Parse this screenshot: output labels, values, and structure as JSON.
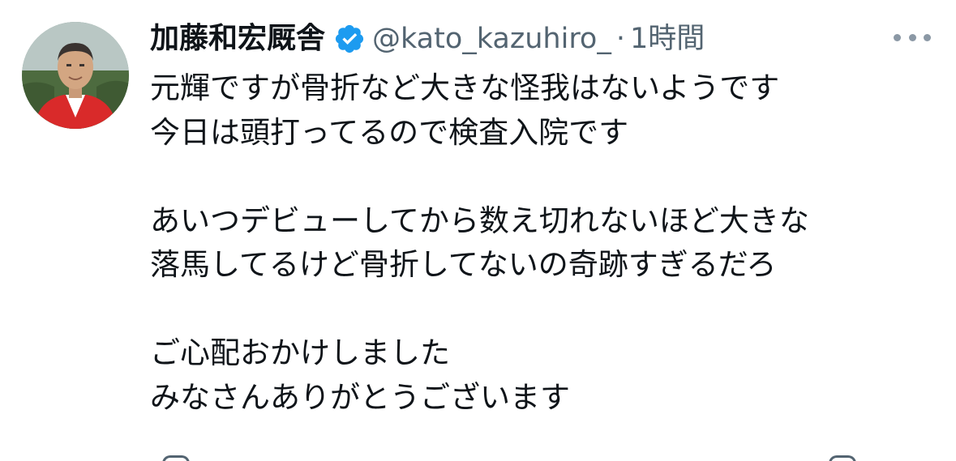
{
  "tweet": {
    "author": {
      "display_name": "加藤和宏厩舎",
      "handle": "@kato_kazuhiro_",
      "verified": true,
      "avatar_icon": "user-avatar-photo"
    },
    "separator": "·",
    "time": "1時間",
    "more_icon": "more-horizontal-icon",
    "body": {
      "line1": "元輝ですが骨折など大きな怪我はないようです",
      "line2": "今日は頭打ってるので検査入院です",
      "line3": "あいつデビューしてから数え切れないほど大きな",
      "line4": "落馬してるけど骨折してないの奇跡すぎるだろ",
      "line5": "ご心配おかけしました",
      "line6": "みなさんありがとうございます"
    }
  },
  "colors": {
    "text_primary": "#0f1419",
    "text_secondary": "#536471",
    "verified_blue": "#1d9bf0",
    "background": "#ffffff"
  }
}
